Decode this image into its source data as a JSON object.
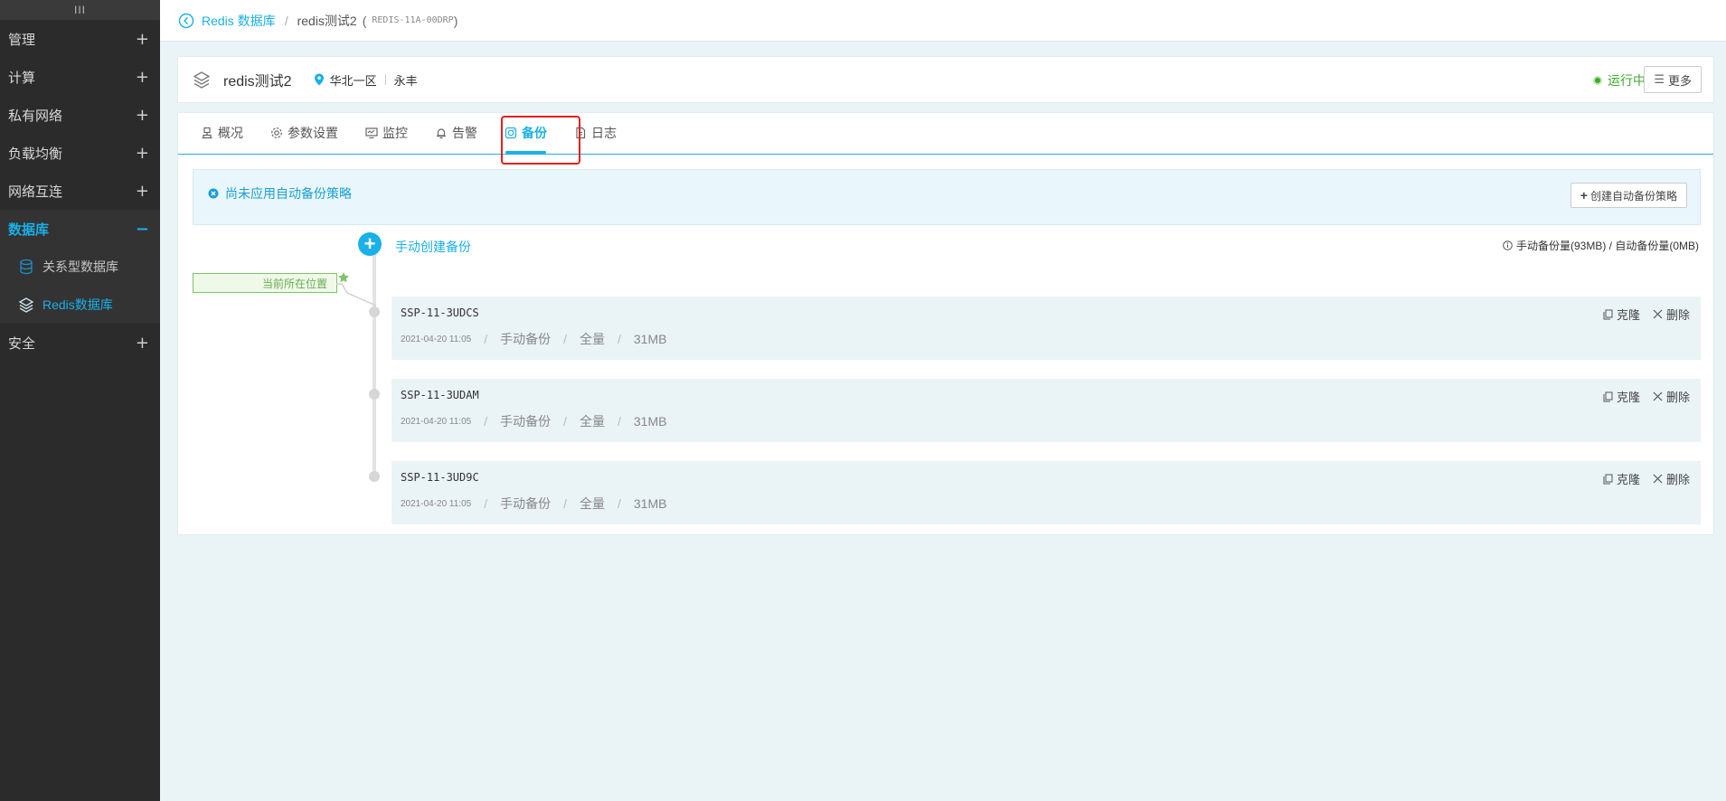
{
  "sidebar": {
    "handle": "III",
    "groups": [
      {
        "label": "管理",
        "toggle": "+"
      },
      {
        "label": "计算",
        "toggle": "+"
      },
      {
        "label": "私有网络",
        "toggle": "+"
      },
      {
        "label": "负载均衡",
        "toggle": "+"
      },
      {
        "label": "网络互连",
        "toggle": "+"
      },
      {
        "label": "数据库",
        "toggle": "−"
      },
      {
        "label": "安全",
        "toggle": "+"
      }
    ],
    "sub_items": [
      {
        "label": "关系型数据库",
        "icon": "database-icon"
      },
      {
        "label": "Redis数据库",
        "icon": "layers-icon"
      }
    ]
  },
  "breadcrumb": {
    "parent": "Redis 数据库",
    "separator": "/",
    "current": "redis测试2",
    "open_paren": "(",
    "instance_id": "REDIS-11A-00DRP",
    "close_paren": ")"
  },
  "instance": {
    "name": "redis测试2",
    "region": "华北一区",
    "zone": "永丰",
    "status": "运行中",
    "more_label": "更多",
    "more_icon": "☰"
  },
  "tabs": [
    {
      "label": "概况",
      "icon": "overview-icon"
    },
    {
      "label": "参数设置",
      "icon": "settings-icon"
    },
    {
      "label": "监控",
      "icon": "monitor-icon"
    },
    {
      "label": "告警",
      "icon": "bell-icon"
    },
    {
      "label": "备份",
      "icon": "backup-icon"
    },
    {
      "label": "日志",
      "icon": "log-icon"
    }
  ],
  "active_tab": "备份",
  "notice": {
    "message": "尚未应用自动备份策略",
    "button": "创建自动备份策略",
    "button_prefix": "+"
  },
  "backup_panel": {
    "add_symbol": "+",
    "manual_create": "手动创建备份",
    "quota": "手动备份量(93MB) / 自动备份量(0MB)",
    "current_position": "当前所在位置",
    "items": [
      {
        "id": "SSP-11-3UDCS",
        "date": "2021-04-20 11:05",
        "type": "手动备份",
        "scope": "全量",
        "size": "31MB"
      },
      {
        "id": "SSP-11-3UDAM",
        "date": "2021-04-20 11:05",
        "type": "手动备份",
        "scope": "全量",
        "size": "31MB"
      },
      {
        "id": "SSP-11-3UD9C",
        "date": "2021-04-20 11:05",
        "type": "手动备份",
        "scope": "全量",
        "size": "31MB"
      }
    ],
    "meta_separator": "/",
    "clone_label": "克隆",
    "delete_label": "删除"
  },
  "colors": {
    "accent": "#1ab0e8",
    "sidebar_bg": "#2b2b2b",
    "running": "#3eaa2a",
    "highlight": "#e41e1e"
  }
}
